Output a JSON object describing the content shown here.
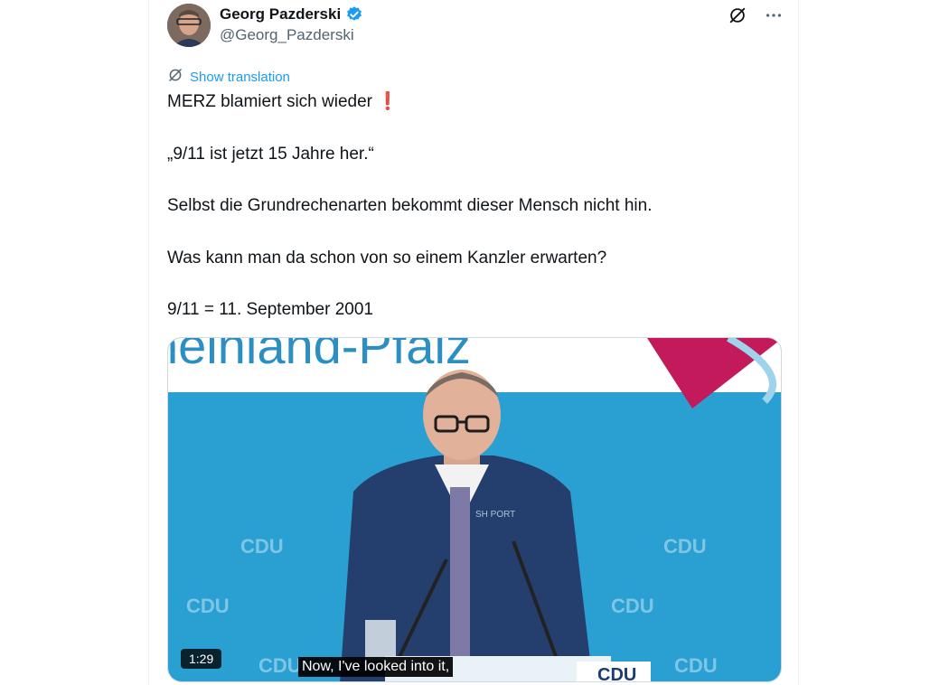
{
  "author": {
    "name": "Georg Pazderski",
    "handle": "@Georg_Pazderski",
    "verified": true
  },
  "actions": {
    "grok_icon": "grok-icon",
    "more_icon": "more-icon"
  },
  "translate": {
    "label": "Show translation"
  },
  "tweet": {
    "lines": [
      "MERZ blamiert sich wieder",
      "„9/11 ist jetzt 15 Jahre her.“",
      "Selbst die Grundrechenarten bekommt dieser Mensch nicht hin.",
      "Was kann man da schon von so einem Kanzler erwarten?",
      "9/11 = 11. September 2001"
    ],
    "emoji": "❗"
  },
  "media": {
    "duration": "1:29",
    "subtitle": "Now, I've looked into it,",
    "backdrop_text": "heinland-Pfalz",
    "logo_text": "CDU",
    "watermark": "SH PORT"
  },
  "colors": {
    "accent": "#1d9bf0",
    "verified": "#1d9bf0",
    "backdrop": "#2a9fd1"
  }
}
